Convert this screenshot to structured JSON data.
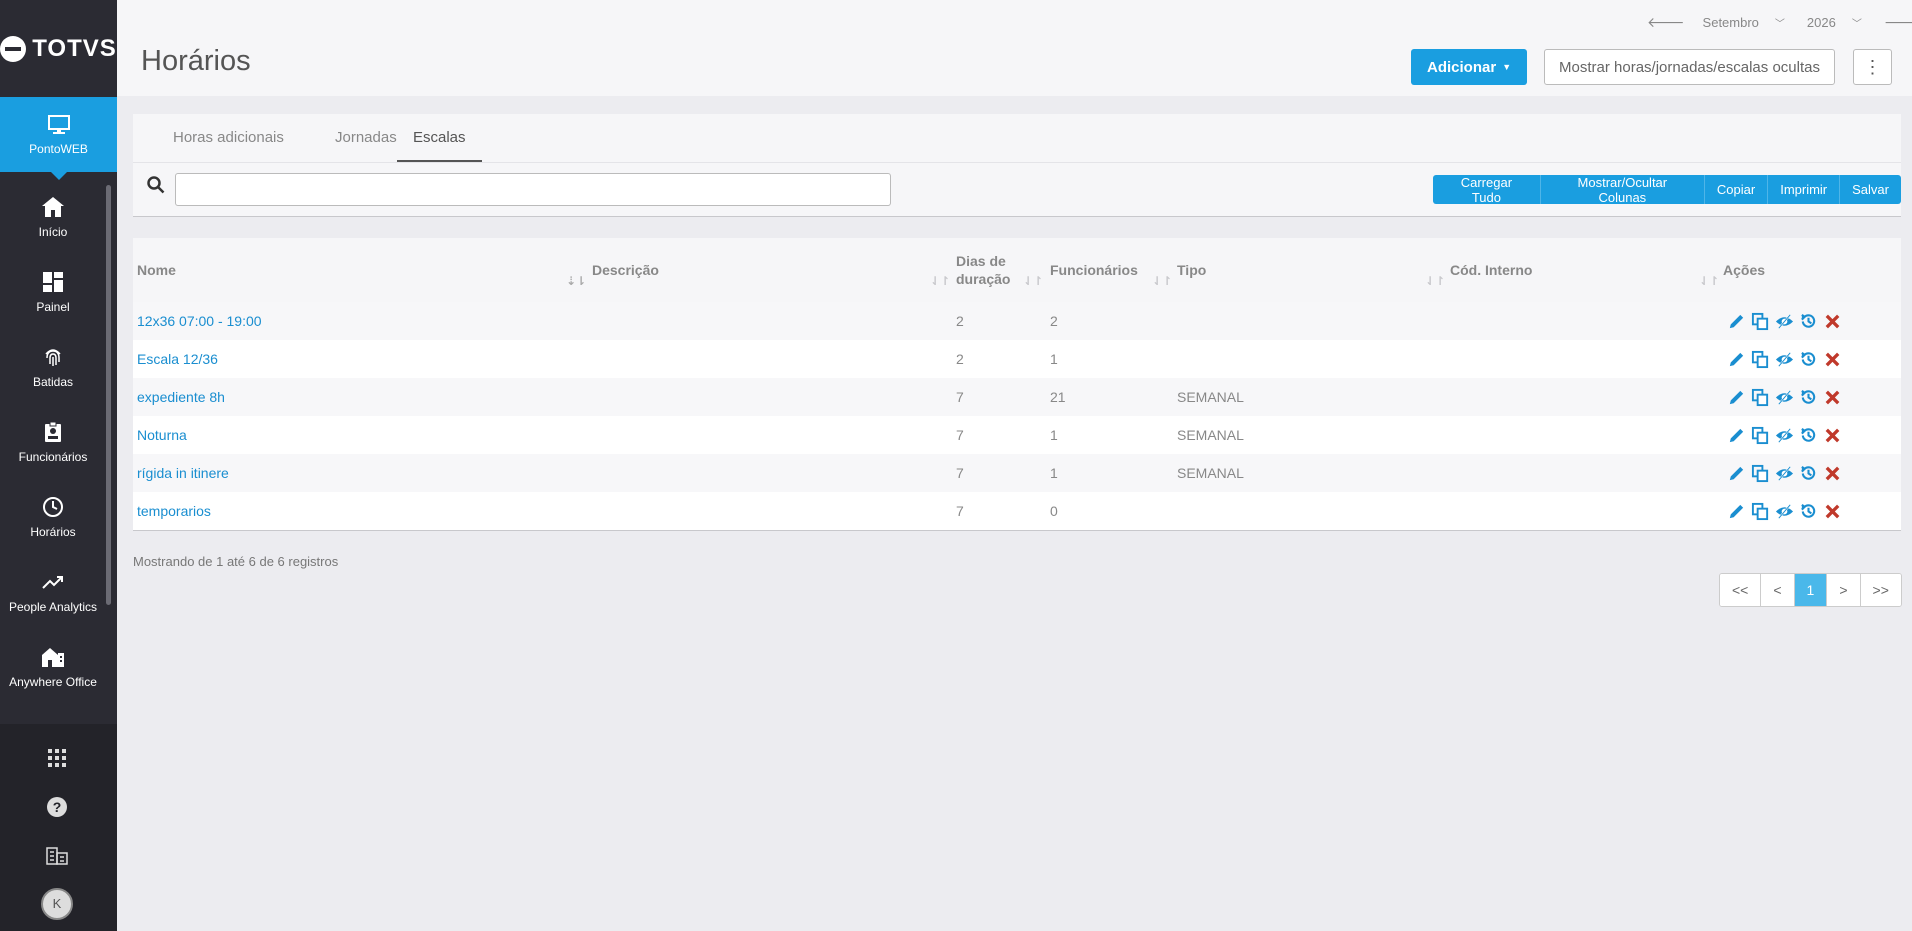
{
  "sidebar": {
    "logo_text": "TOTVS",
    "active_item": {
      "label": "PontoWEB",
      "icon": "monitor-icon"
    },
    "items": [
      {
        "label": "Início",
        "icon": "home-icon"
      },
      {
        "label": "Painel",
        "icon": "dashboard-icon"
      },
      {
        "label": "Batidas",
        "icon": "fingerprint-icon"
      },
      {
        "label": "Funcionários",
        "icon": "badge-icon"
      },
      {
        "label": "Horários",
        "icon": "clock-icon"
      },
      {
        "label": "People Analytics",
        "icon": "trending-up-icon"
      },
      {
        "label": "Anywhere Office",
        "icon": "home-office-icon"
      }
    ],
    "bottom": {
      "icons": [
        "apps-grid-icon",
        "help-icon",
        "building-icon"
      ],
      "avatar_letter": "K"
    }
  },
  "header": {
    "title": "Horários",
    "period": {
      "month": "Setembro",
      "year": "2026"
    },
    "add_button": "Adicionar",
    "hidden_button": "Mostrar horas/jornadas/escalas ocultas",
    "kebab": "⋮"
  },
  "tabs": [
    {
      "label": "Horas adicionais"
    },
    {
      "label": "Jornadas"
    },
    {
      "label": "Escalas"
    }
  ],
  "search": {
    "value": "",
    "placeholder": ""
  },
  "toolbar": {
    "load_all": "Carregar Tudo",
    "toggle_columns": "Mostrar/Ocultar Colunas",
    "copy": "Copiar",
    "print": "Imprimir",
    "save": "Salvar"
  },
  "table": {
    "columns": [
      {
        "label": "Nome"
      },
      {
        "label": "Descrição"
      },
      {
        "label": "Dias de duração"
      },
      {
        "label": "Funcionários"
      },
      {
        "label": "Tipo"
      },
      {
        "label": "Cód. Interno"
      },
      {
        "label": "Ações"
      }
    ],
    "rows": [
      {
        "nome": "12x36 07:00 - 19:00",
        "descricao": "",
        "dias": "2",
        "funcionarios": "2",
        "tipo": "",
        "cod": ""
      },
      {
        "nome": "Escala 12/36",
        "descricao": "",
        "dias": "2",
        "funcionarios": "1",
        "tipo": "",
        "cod": ""
      },
      {
        "nome": "expediente 8h",
        "descricao": "",
        "dias": "7",
        "funcionarios": "21",
        "tipo": "SEMANAL",
        "cod": ""
      },
      {
        "nome": "Noturna",
        "descricao": "",
        "dias": "7",
        "funcionarios": "1",
        "tipo": "SEMANAL",
        "cod": ""
      },
      {
        "nome": "rígida in itinere",
        "descricao": "",
        "dias": "7",
        "funcionarios": "1",
        "tipo": "SEMANAL",
        "cod": ""
      },
      {
        "nome": "temporarios",
        "descricao": "",
        "dias": "7",
        "funcionarios": "0",
        "tipo": "",
        "cod": ""
      }
    ]
  },
  "footer": {
    "info": "Mostrando de 1 até 6 de 6 registros",
    "pager": {
      "first": "<<",
      "prev": "<",
      "current": "1",
      "next": ">",
      "last": ">>"
    }
  },
  "colors": {
    "primary": "#1a9ee0",
    "sidebar": "#2b2b33",
    "delete": "#c0392b"
  }
}
